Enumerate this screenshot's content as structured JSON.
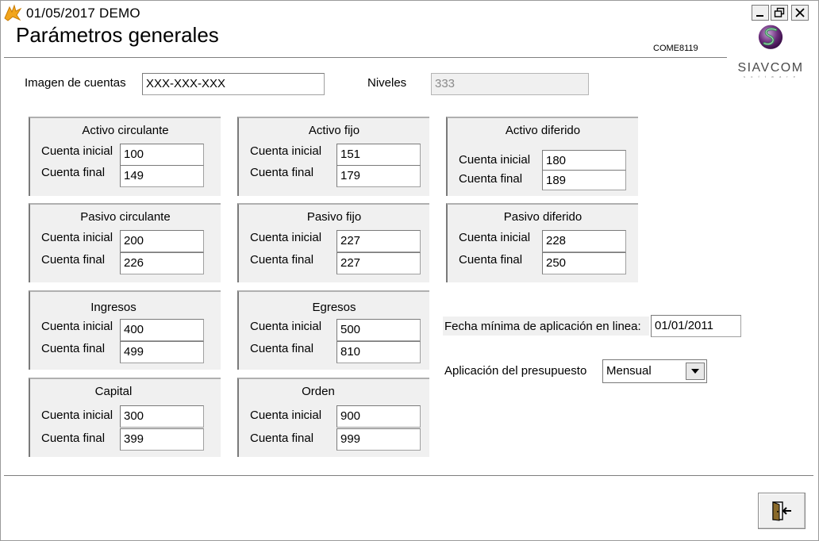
{
  "window": {
    "title": "01/05/2017  DEMO",
    "icons": [
      "app-icon",
      "minimize-icon",
      "restore-icon",
      "close-icon"
    ]
  },
  "header": {
    "title": "Parámetros generales",
    "form_code": "COME8119",
    "logo_text": "SIAVCOM",
    "logo_sub": "s o f t w a r e"
  },
  "top": {
    "imagen_label": "Imagen de cuentas",
    "imagen_value": "XXX-XXX-XXX",
    "niveles_label": "Niveles",
    "niveles_value": "333"
  },
  "labels": {
    "inicial": "Cuenta inicial",
    "final": "Cuenta final"
  },
  "groups": [
    {
      "title": "Activo circulante",
      "inicial": "100",
      "final": "149"
    },
    {
      "title": "Activo fijo",
      "inicial": "151",
      "final": "179"
    },
    {
      "title": "Activo diferido",
      "inicial": "180",
      "final": "189"
    },
    {
      "title": "Pasivo circulante",
      "inicial": "200",
      "final": "226"
    },
    {
      "title": "Pasivo fijo",
      "inicial": "227",
      "final": "227"
    },
    {
      "title": "Pasivo diferido",
      "inicial": "228",
      "final": "250"
    },
    {
      "title": "Ingresos",
      "inicial": "400",
      "final": "499"
    },
    {
      "title": "Egresos",
      "inicial": "500",
      "final": "810"
    },
    {
      "title": "Capital",
      "inicial": "300",
      "final": "399"
    },
    {
      "title": "Orden",
      "inicial": "900",
      "final": "999"
    }
  ],
  "right": {
    "fecha_label": "Fecha mínima de aplicación en linea:",
    "fecha_value": "01/01/2011",
    "presupuesto_label": "Aplicación del presupuesto",
    "presupuesto_value": "Mensual"
  },
  "footer": {
    "exit_icon": "exit-door-icon"
  },
  "colors": {
    "group_bg": "#f0f0f0",
    "logo_purple": "#6a2c7a",
    "logo_green": "#3c8a5a"
  }
}
